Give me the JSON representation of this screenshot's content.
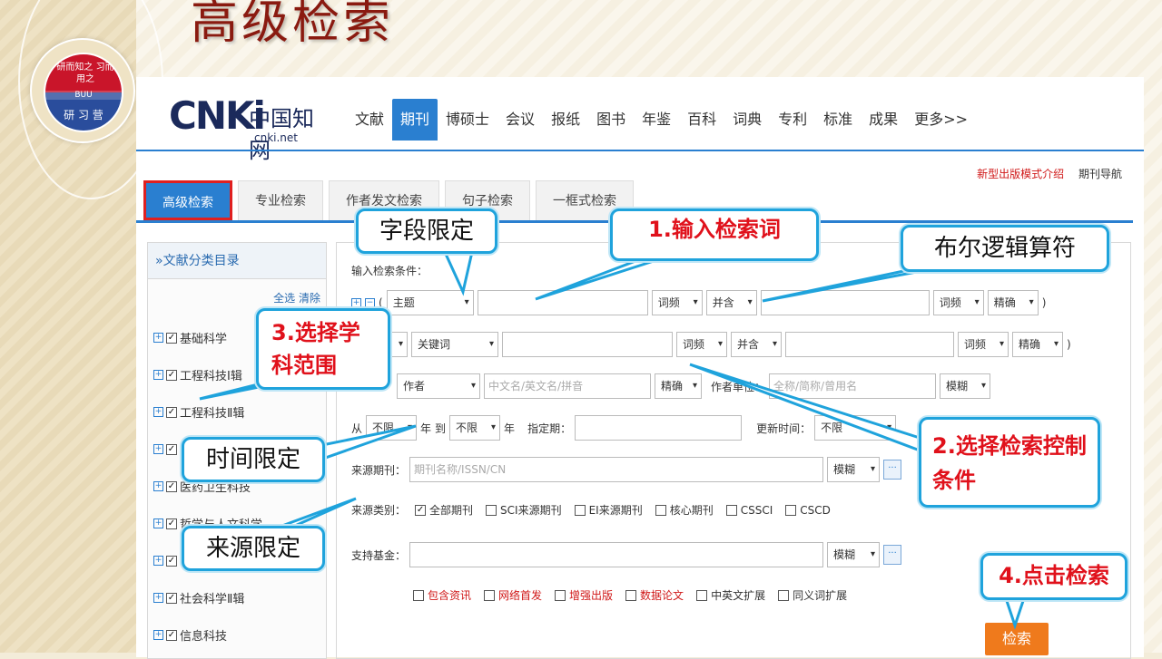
{
  "slide_title": "高级检索",
  "logo": {
    "top": "研而知之 习而用之",
    "mid": "BUU",
    "bot": "研 习 营"
  },
  "header": {
    "brand": "CNKi",
    "brand_zh": "中国知网",
    "brand_domain": "cnki.net",
    "nav": [
      "文献",
      "期刊",
      "博硕士",
      "会议",
      "报纸",
      "图书",
      "年鉴",
      "百科",
      "词典",
      "专利",
      "标准",
      "成果",
      "更多>>"
    ],
    "nav_active_index": 1,
    "top_links": [
      "新型出版模式介绍",
      "期刊导航"
    ]
  },
  "tabs": [
    "高级检索",
    "专业检索",
    "作者发文检索",
    "句子检索",
    "一框式检索"
  ],
  "active_tab_index": 0,
  "sidebar": {
    "title": "»文献分类目录",
    "select_all": "全选",
    "clear": "清除",
    "items": [
      "基础科学",
      "工程科技Ⅰ辑",
      "工程科技Ⅱ辑",
      "",
      "医药卫生科技",
      "哲学与人文科学",
      "",
      "社会科学Ⅱ辑",
      "信息科技"
    ]
  },
  "form": {
    "label": "输入检索条件：",
    "row1": {
      "plus": "+",
      "minus": "−",
      "paren_open": "(",
      "paren_close": ")",
      "field": "主题",
      "freq": "词频",
      "op": "并含",
      "freq2": "词频",
      "match": "精确"
    },
    "row2": {
      "op_left": "并且",
      "field": "关键词",
      "freq": "词频",
      "op": "并含",
      "freq2": "词频",
      "match": "精确",
      "paren_close": ")"
    },
    "row3": {
      "field": "作者",
      "placeholder": "中文名/英文名/拼音",
      "match": "精确",
      "unit_label": "作者单位：",
      "unit_placeholder": "全称/简称/曾用名",
      "match2": "模糊"
    },
    "row4": {
      "from": "从",
      "from_val": "不限",
      "year1": "年",
      "to": "到",
      "to_val": "不限",
      "year2": "年",
      "specify": "指定期：",
      "update_label": "更新时间：",
      "update_val": "不限"
    },
    "row5": {
      "label": "来源期刊：",
      "placeholder": "期刊名称/ISSN/CN",
      "match": "模糊",
      "more": "···"
    },
    "row6": {
      "label": "来源类别：",
      "options": [
        "全部期刊",
        "SCI来源期刊",
        "EI来源期刊",
        "核心期刊",
        "CSSCI",
        "CSCD"
      ]
    },
    "row7": {
      "label": "支持基金：",
      "match": "模糊",
      "more": "···"
    },
    "row8": {
      "options": [
        "包含资讯",
        "网络首发",
        "增强出版",
        "数据论文",
        "中英文扩展",
        "同义词扩展"
      ]
    },
    "search_button": "检索"
  },
  "callouts": {
    "field_limit": "字段限定",
    "input_terms": "1.输入检索词",
    "boolean": "布尔逻辑算符",
    "subject_range": "3.选择学科范围",
    "time_limit": "时间限定",
    "control": "2.选择检索控制条件",
    "source_limit": "来源限定",
    "click_search": "4.点击检索"
  },
  "colors": {
    "accent": "#2a7fd0",
    "callout_border": "#1fa3dc",
    "callout_red": "#e0111b",
    "search_btn": "#ef7a1c",
    "title": "#8a1a10"
  }
}
